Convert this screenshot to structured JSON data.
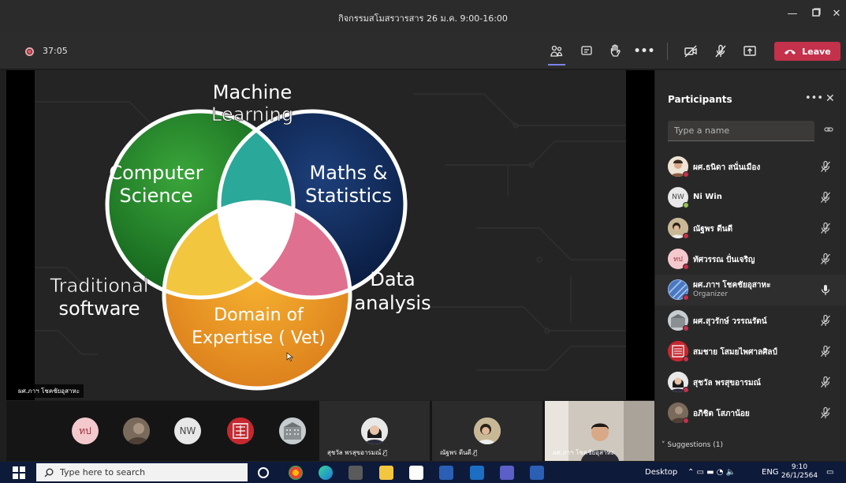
{
  "window": {
    "title": "กิจกรรมสโมสรวารสาร 26 ม.ค. 9:00-16:00"
  },
  "toolbar": {
    "timer": "37:05",
    "leave_label": "Leave"
  },
  "slide": {
    "label_ml_1": "Machine",
    "label_ml_2": "Learning",
    "label_cs_1": "Computer",
    "label_cs_2": "Science",
    "label_ms_1": "Maths &",
    "label_ms_2": "Statistics",
    "label_ts_1": "Traditional",
    "label_ts_2": "software",
    "label_da_1": "Data",
    "label_da_2": "analysis",
    "label_de_1": "Domain of",
    "label_de_2": "Expertise ( Vet)",
    "colors": {
      "cs": "#1f8a2a",
      "ms": "#0e2a5c",
      "de": "#f0a020",
      "ml": "#2aa89a",
      "ts": "#f3c640",
      "da": "#e07090"
    }
  },
  "presenter_tag": "ผศ.ภาฯ โชคชัยอุสาหะ",
  "strip": {
    "avatars": [
      {
        "initials": "ทป",
        "bg": "#f4c9cd",
        "fg": "#9a3040"
      },
      {
        "initials": "NW",
        "bg": "#e8e8e8",
        "fg": "#4a4a4a"
      }
    ],
    "tiles": [
      {
        "name": "สุชวัล พรสุขอารมณ์"
      },
      {
        "name": "ณัฐพร ดีนดี"
      },
      {
        "name": "ผศ.ภาฯ โชคชัยอุสาหะ"
      }
    ]
  },
  "panel": {
    "title": "Participants",
    "search_placeholder": "Type a name",
    "participants": [
      {
        "name": "ผศ.ธนิดา สนั่นเมือง",
        "initials": "",
        "role": "",
        "organizer": false,
        "status": "busy"
      },
      {
        "name": "Ni Win",
        "initials": "NW",
        "role": "",
        "organizer": false,
        "status": "online"
      },
      {
        "name": "ณัฐพร ดีนดี",
        "initials": "",
        "role": "",
        "organizer": false,
        "status": "busy"
      },
      {
        "name": "ทัศวรรณ ปั่นเจริญ",
        "initials": "ทป",
        "role": "",
        "organizer": false,
        "status": "busy"
      },
      {
        "name": "ผศ.ภาฯ โชคชัยอุสาหะ",
        "initials": "",
        "role": "Organizer",
        "organizer": true,
        "status": "busy"
      },
      {
        "name": "ผศ.สุวรักษ์ วรรณรัตน์",
        "initials": "",
        "role": "",
        "organizer": false,
        "status": "busy"
      },
      {
        "name": "สมชาย โสมยไพศาลศิลป์",
        "initials": "",
        "role": "",
        "organizer": false,
        "status": "busy"
      },
      {
        "name": "สุชวัล พรสุขอารมณ์",
        "initials": "",
        "role": "",
        "organizer": false,
        "status": "busy"
      },
      {
        "name": "อภิชิต โสภาน้อย",
        "initials": "",
        "role": "",
        "organizer": false,
        "status": "busy"
      }
    ],
    "suggestions_label": "Suggestions (1)"
  },
  "taskbar": {
    "search_placeholder": "Type here to search",
    "desktop_label": "Desktop",
    "lang": "ENG",
    "time": "9:10",
    "date": "26/1/2564"
  }
}
